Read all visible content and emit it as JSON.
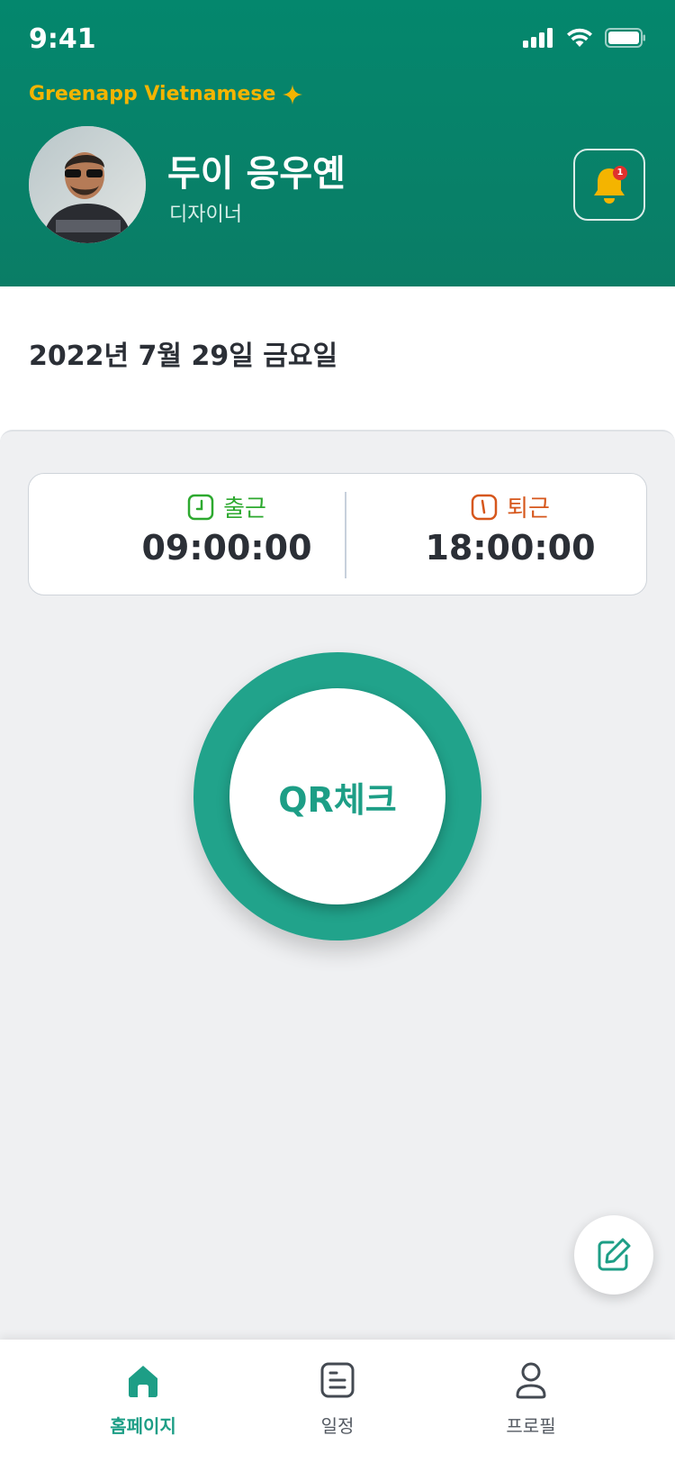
{
  "status_bar": {
    "time": "9:41"
  },
  "header": {
    "org_name": "Greenapp Vietnamese",
    "user_name": "두이 응우옌",
    "user_role": "디자이너",
    "notification_count": "1"
  },
  "date_title": "2022년 7월 29일 금요일",
  "attendance": {
    "check_in_label": "출근",
    "check_in_time": "09:00:00",
    "check_out_label": "퇴근",
    "check_out_time": "18:00:00"
  },
  "qr_button_label": "QR체크",
  "tabs": [
    {
      "label": "홈페이지",
      "icon": "home-icon",
      "active": true
    },
    {
      "label": "일정",
      "icon": "document-icon",
      "active": false
    },
    {
      "label": "프로필",
      "icon": "user-icon",
      "active": false
    }
  ],
  "colors": {
    "header_green": "#04876d",
    "accent_teal": "#21a38b",
    "org_name_gold": "#f4b400",
    "check_in_green": "#2da92f",
    "check_out_orange": "#d6571c",
    "badge_red": "#e0312d"
  }
}
